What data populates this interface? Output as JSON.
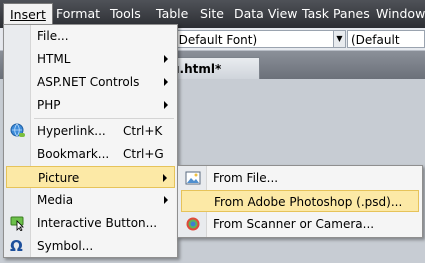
{
  "menubar": {
    "items": [
      "Insert",
      "Format",
      "Tools",
      "Table",
      "Site",
      "Data View",
      "Task Panes",
      "Window"
    ],
    "active": "Insert"
  },
  "toolbar": {
    "font_combo": "(Default Font)",
    "size_combo": "(Default Size)"
  },
  "document": {
    "tab_label": "u.html*"
  },
  "insert_menu": {
    "items": [
      {
        "label": "File...",
        "submenu": false
      },
      {
        "label": "HTML",
        "submenu": true
      },
      {
        "label": "ASP.NET Controls",
        "submenu": true
      },
      {
        "label": "PHP",
        "submenu": true
      },
      {
        "label": "Hyperlink...",
        "shortcut": "Ctrl+K",
        "icon": "hyperlink-globe-icon"
      },
      {
        "label": "Bookmark...",
        "shortcut": "Ctrl+G"
      },
      {
        "label": "Picture",
        "submenu": true,
        "highlighted": true
      },
      {
        "label": "Media",
        "submenu": true
      },
      {
        "label": "Interactive Button...",
        "icon": "interactive-button-icon"
      },
      {
        "label": "Symbol...",
        "icon": "omega-symbol-icon"
      }
    ]
  },
  "picture_submenu": {
    "items": [
      {
        "label": "From File...",
        "icon": "image-file-icon"
      },
      {
        "label": "From Adobe Photoshop (.psd)...",
        "highlighted": true
      },
      {
        "label": "From Scanner or Camera...",
        "icon": "scanner-camera-icon"
      }
    ]
  },
  "colors": {
    "menubar_bg": "#2c2e33",
    "highlight_bg": "#fce9a6",
    "highlight_border": "#e6c35a",
    "menu_bg": "#f5f5f5"
  }
}
